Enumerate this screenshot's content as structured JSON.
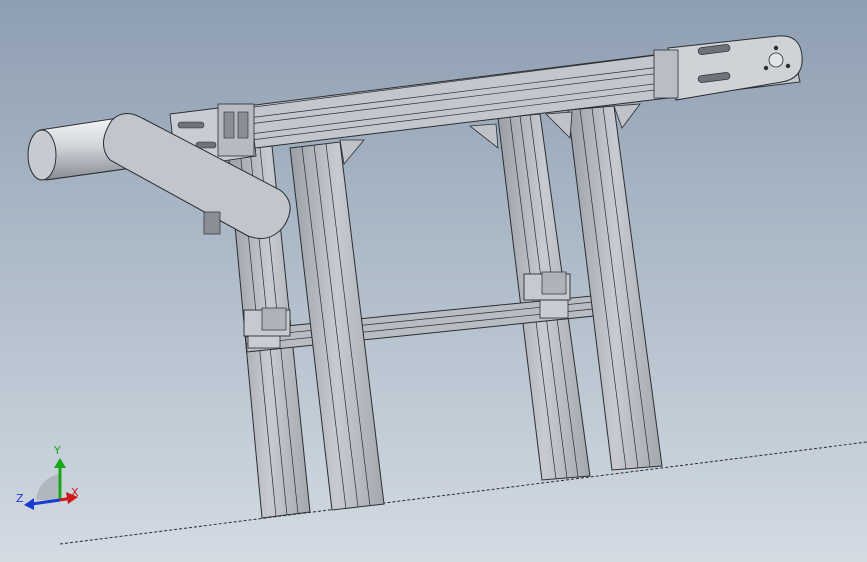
{
  "colors": {
    "background_top": "#8e9fb2",
    "background_bottom": "#d3dbe3",
    "metal_light": "#d4d7dc",
    "metal_mid": "#b3b7be",
    "metal_dark": "#8a8f97",
    "edge": "#2b2d31",
    "axis_x": "#d01818",
    "axis_y": "#16a816",
    "axis_z": "#1a3ad0"
  },
  "triad": {
    "y_label": "Y",
    "z_label": "Z",
    "x_label": "X"
  }
}
